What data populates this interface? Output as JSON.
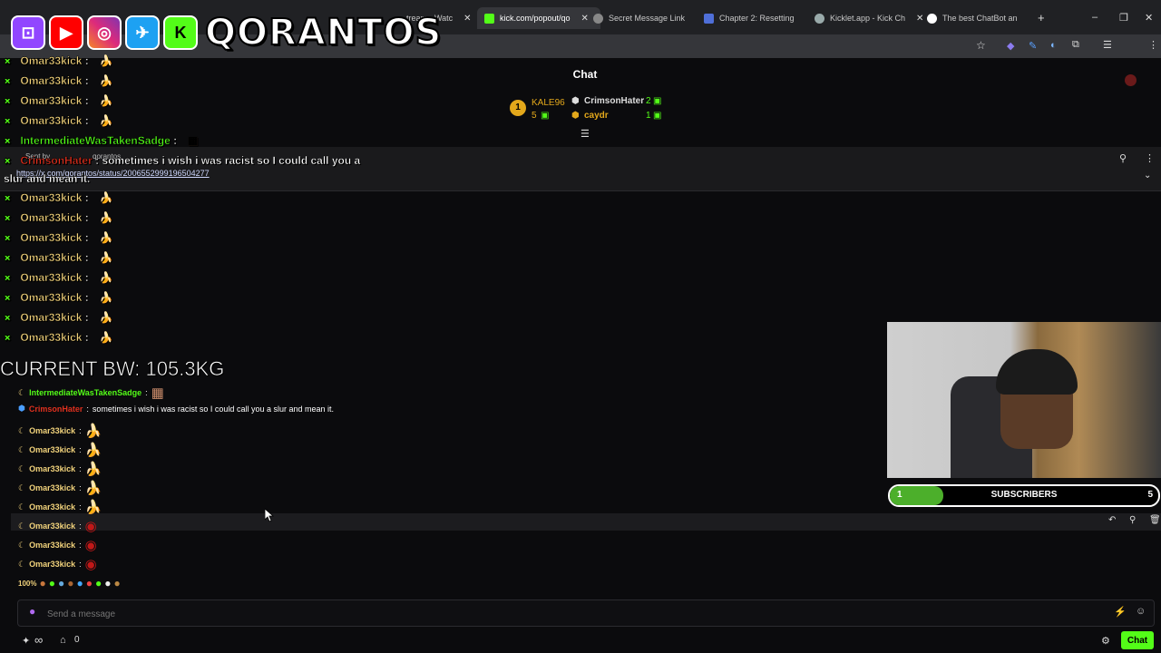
{
  "browser": {
    "tabs": [
      {
        "label": "tream - Watc",
        "active": false
      },
      {
        "label": "kick.com/popout/qo",
        "active": true
      },
      {
        "label": "Secret Message Link",
        "active": false
      },
      {
        "label": "Chapter 2: Resetting",
        "active": false
      },
      {
        "label": "Kicklet.app - Kick Ch",
        "active": false
      },
      {
        "label": "The best ChatBot an",
        "active": false
      }
    ],
    "new_tab": "+",
    "window_controls": [
      "–",
      "❐",
      "✕"
    ]
  },
  "overlay": {
    "brand": "QORANTOS",
    "social_icons": [
      "twitch-icon",
      "youtube-icon",
      "instagram-icon",
      "twitter-icon",
      "kick-icon"
    ],
    "current_bw": "CURRENT BW: 105.3KG",
    "chat_lines": [
      {
        "user": "Omar33kick",
        "sep": " :",
        "emote": "banana"
      },
      {
        "user": "Omar33kick",
        "sep": " :",
        "emote": "banana"
      },
      {
        "user": "Omar33kick",
        "sep": " :",
        "emote": "banana"
      },
      {
        "user": "Omar33kick",
        "sep": " :",
        "emote": "banana"
      },
      {
        "user": "IntermediateWasTakenSadge",
        "sep": " :",
        "emote": "face"
      },
      {
        "user": "CrimsonHater",
        "sep": " : sometimes i wish i was racist so I could call you a",
        "emote": ""
      },
      {
        "user": "slur and mean it.",
        "sep": "",
        "emote": ""
      },
      {
        "user": "Omar33kick",
        "sep": " :",
        "emote": "banana"
      },
      {
        "user": "Omar33kick",
        "sep": " :",
        "emote": "banana"
      },
      {
        "user": "Omar33kick",
        "sep": " :",
        "emote": "banana"
      },
      {
        "user": "Omar33kick",
        "sep": " :",
        "emote": "banana"
      },
      {
        "user": "Omar33kick",
        "sep": " :",
        "emote": "banana"
      },
      {
        "user": "Omar33kick",
        "sep": " :",
        "emote": "banana"
      },
      {
        "user": "Omar33kick",
        "sep": " :",
        "emote": "banana"
      },
      {
        "user": "Omar33kick",
        "sep": " :",
        "emote": "banana"
      }
    ]
  },
  "chat": {
    "title": "Chat",
    "leaderboard": {
      "rank": "1",
      "entries": [
        {
          "name": "KALE96",
          "value": "5"
        },
        {
          "name": "CrimsonHater",
          "value": "2"
        },
        {
          "name": "caydr",
          "value": "1"
        }
      ]
    },
    "pinned": {
      "sent_by": "Sent by",
      "pinner": "qorantos",
      "link": "https://x.com/qorantos/status/2006552999196504277"
    },
    "messages": [
      {
        "user": "IntermediateWasTakenSadge",
        "sep": ":",
        "text": "",
        "emote": "face",
        "color": "#53fc18"
      },
      {
        "user": "CrimsonHater",
        "sep": ":",
        "text": "sometimes i wish i was racist so I could call you a slur and mean it.",
        "emote": "",
        "color": "#e0301e"
      },
      {
        "user": "Omar33kick",
        "sep": ":",
        "text": "",
        "emote": "banana",
        "color": "#f1d27b"
      },
      {
        "user": "Omar33kick",
        "sep": ":",
        "text": "",
        "emote": "banana",
        "color": "#f1d27b"
      },
      {
        "user": "Omar33kick",
        "sep": ":",
        "text": "",
        "emote": "banana",
        "color": "#f1d27b"
      },
      {
        "user": "Omar33kick",
        "sep": ":",
        "text": "",
        "emote": "banana",
        "color": "#f1d27b"
      },
      {
        "user": "Omar33kick",
        "sep": ":",
        "text": "",
        "emote": "banana",
        "color": "#f1d27b"
      },
      {
        "user": "Omar33kick",
        "sep": ":",
        "text": "",
        "emote": "red-bowl",
        "color": "#f1d27b"
      },
      {
        "user": "Omar33kick",
        "sep": ":",
        "text": "",
        "emote": "red-bowl",
        "color": "#f1d27b"
      },
      {
        "user": "Omar33kick",
        "sep": ":",
        "text": "",
        "emote": "red-bowl",
        "color": "#f1d27b"
      }
    ],
    "emote_bar_first": "100%",
    "input_placeholder": "Send a message",
    "bottom": {
      "infinity": "∞",
      "count": "0",
      "chat_button": "Chat"
    }
  },
  "subscribers": {
    "label": "SUBSCRIBERS",
    "current": "1",
    "goal": "5",
    "progress": 0.2
  },
  "colors": {
    "kick_green": "#53fc18",
    "username_gold": "#f1d27b",
    "crimson": "#e0301e"
  }
}
